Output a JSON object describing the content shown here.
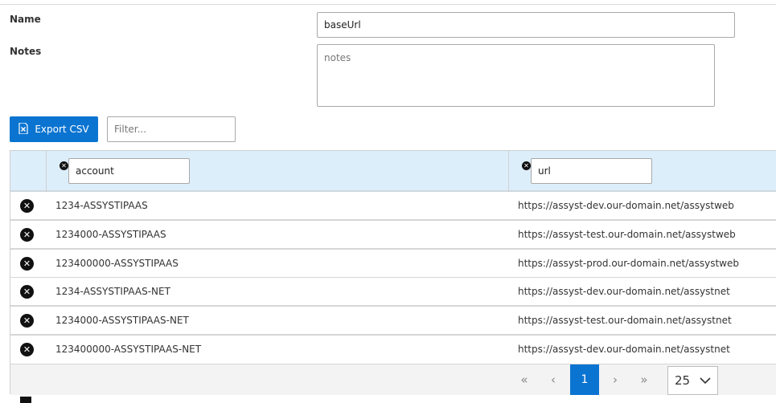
{
  "form": {
    "name_label": "Name",
    "name_value": "baseUrl",
    "notes_label": "Notes",
    "notes_placeholder": "notes"
  },
  "toolbar": {
    "export_label": "Export CSV",
    "filter_placeholder": "Filter..."
  },
  "table": {
    "filters": {
      "account": "account",
      "url": "url"
    },
    "rows": [
      {
        "account": "1234-ASSYSTIPAAS",
        "url": "https://assyst-dev.our-domain.net/assystweb"
      },
      {
        "account": "1234000-ASSYSTIPAAS",
        "url": "https://assyst-test.our-domain.net/assystweb"
      },
      {
        "account": "123400000-ASSYSTIPAAS",
        "url": "https://assyst-prod.our-domain.net/assystweb"
      },
      {
        "account": "1234-ASSYSTIPAAS-NET",
        "url": "https://assyst-dev.our-domain.net/assystnet"
      },
      {
        "account": "1234000-ASSYSTIPAAS-NET",
        "url": "https://assyst-test.our-domain.net/assystnet"
      },
      {
        "account": "123400000-ASSYSTIPAAS-NET",
        "url": "https://assyst-dev.our-domain.net/assystnet"
      }
    ]
  },
  "pagination": {
    "first": "«",
    "prev": "‹",
    "current_page": "1",
    "next": "›",
    "last": "»",
    "page_size": "25"
  },
  "colors": {
    "accent": "#0b74d1",
    "header_bg": "#ddeefb",
    "footer_bg": "#f3f3f3"
  },
  "icons": {
    "export": "file-excel-icon",
    "clear_filter": "clear-icon",
    "row_delete": "remove-row-icon",
    "page_size_toggle": "chevron-down-icon",
    "add_row": "add-icon"
  }
}
